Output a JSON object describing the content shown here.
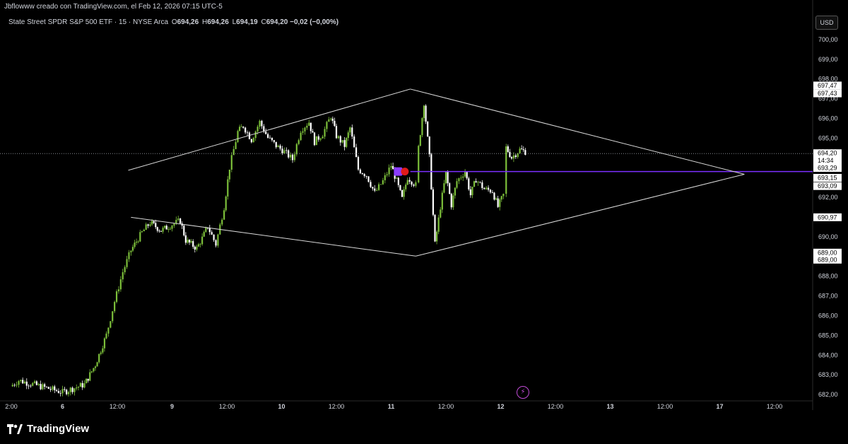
{
  "caption": "Jbflowww creado con TradingView.com, el Feb 12, 2026 07:15 UTC-5",
  "legend": {
    "symbol": "State Street SPDR S&P 500 ETF · 15 · NYSE Arca",
    "o_label": "O",
    "o_value": "694,26",
    "h_label": "H",
    "h_value": "694,26",
    "l_label": "L",
    "l_value": "694,19",
    "c_label": "C",
    "c_value": "694,20",
    "change": "−0,02 (−0,00%)"
  },
  "currency_button": "USD",
  "brand": "TradingView",
  "colors": {
    "background": "#000000",
    "candle_up": "#7cbf3a",
    "candle_down": "#ffffff",
    "trendline": "#d9d9d9",
    "hline": "#7b2fff",
    "badge_bg": "#ffffff",
    "badge_text": "#000000"
  },
  "chart_data": {
    "type": "candlestick",
    "ylim": [
      681.7,
      700.55
    ],
    "yticks": [
      "682,00",
      "683,00",
      "684,00",
      "685,00",
      "686,00",
      "687,00",
      "688,00",
      "689,00",
      "690,00",
      "691,00",
      "692,00",
      "693,00",
      "694,00",
      "695,00",
      "696,00",
      "697,00",
      "698,00",
      "699,00",
      "700,00"
    ],
    "ytick_values": [
      682,
      683,
      684,
      685,
      686,
      687,
      688,
      689,
      690,
      691,
      692,
      693,
      694,
      695,
      696,
      697,
      698,
      699,
      700
    ],
    "xticks": [
      "2:00",
      "6",
      "12:00",
      "9",
      "12:00",
      "10",
      "12:00",
      "11",
      "12:00",
      "12",
      "12:00",
      "13",
      "12:00",
      "17",
      "12:00"
    ],
    "xtick_bold": [
      false,
      true,
      false,
      true,
      false,
      true,
      false,
      true,
      false,
      true,
      false,
      true,
      false,
      true,
      false
    ],
    "xtick_positions": [
      0.0,
      1.0,
      2.0,
      3.0,
      4.0,
      5.0,
      6.0,
      7.0,
      8.0,
      9.0,
      10.0,
      11.0,
      12.0,
      13.0,
      14.0
    ],
    "price_badges": [
      {
        "label": "697,47",
        "value": 697.47
      },
      {
        "label": "697,43",
        "value": 697.43
      },
      {
        "label": "694,20",
        "value": 694.2,
        "sub": "14:34"
      },
      {
        "label": "693,29",
        "value": 693.29
      },
      {
        "label": "693,15",
        "value": 693.15
      },
      {
        "label": "693,09",
        "value": 693.09
      },
      {
        "label": "690,97",
        "value": 690.97
      },
      {
        "label": "689,00",
        "value": 689.0
      },
      {
        "label": "689,00",
        "value": 689.0
      }
    ],
    "last_price": 694.2,
    "horizontal_line": 693.29,
    "trendlines": [
      {
        "points": [
          [
            2.2,
            693.35
          ],
          [
            7.35,
            697.47
          ]
        ]
      },
      {
        "points": [
          [
            7.35,
            697.47
          ],
          [
            13.45,
            693.15
          ]
        ]
      },
      {
        "points": [
          [
            2.25,
            690.97
          ],
          [
            7.45,
            689.0
          ]
        ]
      },
      {
        "points": [
          [
            7.45,
            689.0
          ],
          [
            13.45,
            693.15
          ]
        ]
      }
    ],
    "price_path": [
      [
        0.05,
        682.4
      ],
      [
        0.2,
        682.7
      ],
      [
        1.0,
        682.1
      ],
      [
        1.4,
        682.5
      ],
      [
        1.6,
        683.5
      ],
      [
        1.8,
        685.0
      ],
      [
        1.95,
        686.7
      ],
      [
        2.1,
        688.2
      ],
      [
        2.25,
        689.3
      ],
      [
        2.45,
        690.2
      ],
      [
        2.6,
        690.7
      ],
      [
        2.8,
        690.3
      ],
      [
        3.0,
        690.6
      ],
      [
        3.15,
        690.8
      ],
      [
        3.25,
        689.8
      ],
      [
        3.45,
        689.4
      ],
      [
        3.55,
        689.9
      ],
      [
        3.65,
        690.5
      ],
      [
        3.8,
        689.6
      ],
      [
        3.95,
        691.5
      ],
      [
        4.05,
        693.5
      ],
      [
        4.2,
        695.3
      ],
      [
        4.3,
        695.6
      ],
      [
        4.45,
        694.9
      ],
      [
        4.6,
        695.8
      ],
      [
        4.75,
        695.0
      ],
      [
        4.9,
        694.6
      ],
      [
        5.05,
        694.3
      ],
      [
        5.2,
        693.9
      ],
      [
        5.35,
        695.4
      ],
      [
        5.5,
        695.8
      ],
      [
        5.6,
        694.8
      ],
      [
        5.75,
        695.2
      ],
      [
        5.9,
        696.1
      ],
      [
        6.0,
        695.1
      ],
      [
        6.15,
        694.6
      ],
      [
        6.25,
        695.5
      ],
      [
        6.4,
        693.4
      ],
      [
        6.55,
        693.1
      ],
      [
        6.7,
        692.2
      ],
      [
        6.85,
        692.8
      ],
      [
        7.0,
        693.6
      ],
      [
        7.1,
        692.8
      ],
      [
        7.2,
        691.9
      ],
      [
        7.3,
        693.0
      ],
      [
        7.45,
        692.6
      ],
      [
        7.5,
        694.5
      ],
      [
        7.6,
        696.8
      ],
      [
        7.7,
        694.0
      ],
      [
        7.8,
        689.6
      ],
      [
        7.9,
        691.5
      ],
      [
        8.0,
        693.2
      ],
      [
        8.1,
        691.6
      ],
      [
        8.2,
        692.8
      ],
      [
        8.35,
        693.3
      ],
      [
        8.45,
        692.1
      ],
      [
        8.55,
        692.9
      ],
      [
        8.7,
        692.4
      ],
      [
        8.85,
        692.3
      ],
      [
        8.95,
        691.5
      ],
      [
        9.05,
        692.1
      ],
      [
        9.1,
        694.5
      ],
      [
        9.2,
        694.0
      ],
      [
        9.35,
        694.4
      ],
      [
        9.45,
        694.3
      ]
    ]
  }
}
